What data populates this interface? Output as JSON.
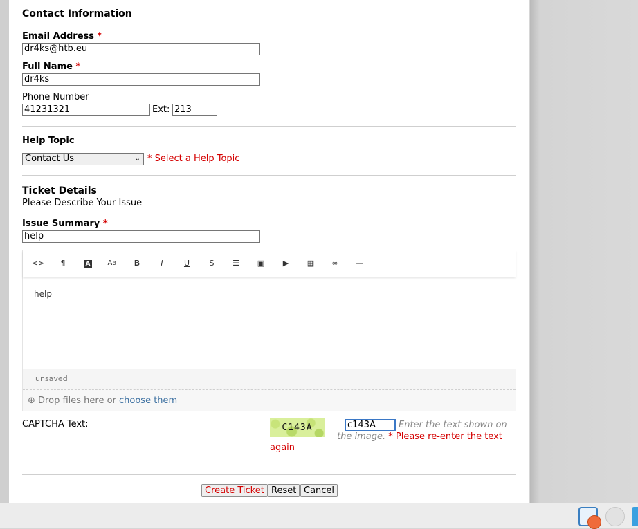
{
  "contact": {
    "heading": "Contact Information",
    "email_label": "Email Address",
    "email_value": "dr4ks@htb.eu",
    "name_label": "Full Name",
    "name_value": "dr4ks",
    "phone_label": "Phone Number",
    "phone_value": "41231321",
    "ext_label": "Ext:",
    "ext_value": "213",
    "required_mark": "*"
  },
  "help_topic": {
    "heading": "Help Topic",
    "selected": "Contact Us",
    "error": "* Select a Help Topic"
  },
  "ticket": {
    "heading": "Ticket Details",
    "subheading": "Please Describe Your Issue",
    "summary_label": "Issue Summary",
    "summary_value": "help",
    "body_text": "help",
    "status": "unsaved",
    "drop_text": "Drop files here or ",
    "drop_link": "choose them",
    "toolbar": [
      {
        "name": "html-icon",
        "glyph": "<>"
      },
      {
        "name": "paragraph-icon",
        "glyph": "¶"
      },
      {
        "name": "text-color-icon",
        "glyph": "A"
      },
      {
        "name": "font-size-icon",
        "glyph": "Aa"
      },
      {
        "name": "bold-icon",
        "glyph": "B"
      },
      {
        "name": "italic-icon",
        "glyph": "I"
      },
      {
        "name": "underline-icon",
        "glyph": "U"
      },
      {
        "name": "strikethrough-icon",
        "glyph": "S"
      },
      {
        "name": "list-icon",
        "glyph": "☰"
      },
      {
        "name": "image-icon",
        "glyph": "▣"
      },
      {
        "name": "video-icon",
        "glyph": "▶"
      },
      {
        "name": "table-icon",
        "glyph": "▦"
      },
      {
        "name": "link-icon",
        "glyph": "∞"
      },
      {
        "name": "horizontal-rule-icon",
        "glyph": "—"
      }
    ]
  },
  "captcha": {
    "label": "CAPTCHA Text:",
    "image_text": "C143A",
    "input_value": "c143A",
    "hint": "Enter the text shown on the image.",
    "error_line1": "* Please re-enter the text",
    "error_line2": "again"
  },
  "actions": {
    "create": "Create Ticket",
    "reset": "Reset",
    "cancel": "Cancel"
  },
  "colors": {
    "required": "#d40000",
    "link": "#3b6fa0",
    "create_text": "#d40000"
  }
}
